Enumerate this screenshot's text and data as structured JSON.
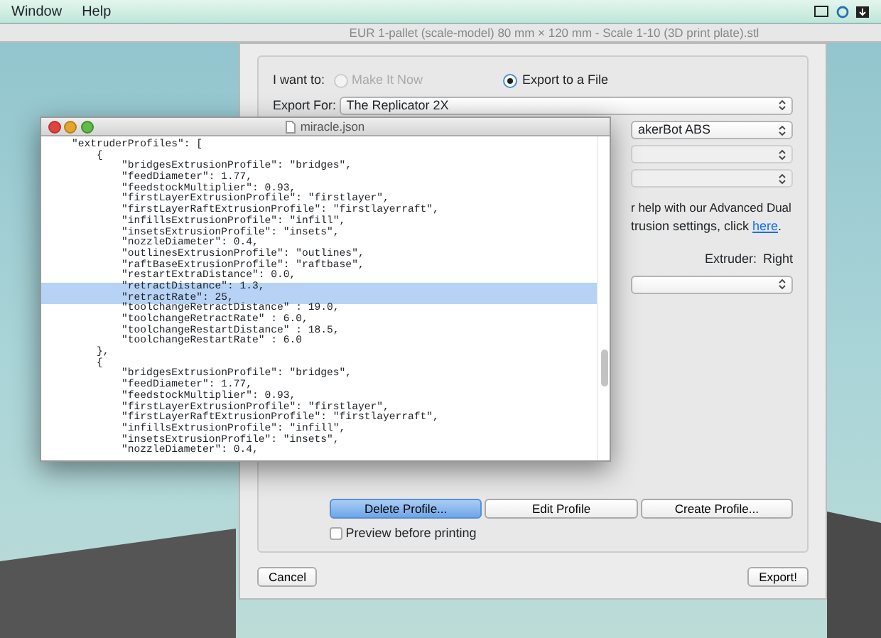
{
  "menu_bar": {
    "items": [
      "Window",
      "Help"
    ]
  },
  "window": {
    "title": "EUR 1-pallet (scale-model) 80 mm × 120 mm - Scale 1-10 (3D print plate).stl"
  },
  "export_dialog": {
    "intent_label": "I want to:",
    "intent_options": [
      {
        "label": "Make It Now",
        "selected": false,
        "disabled": true
      },
      {
        "label": "Export to a File",
        "selected": true,
        "disabled": false
      }
    ],
    "export_for": {
      "label": "Export For:",
      "value": "The Replicator 2X"
    },
    "dropdowns": [
      {
        "value": "akerBot ABS",
        "disabled": false
      },
      {
        "disabled": true
      },
      {
        "disabled": true
      }
    ],
    "help_text": {
      "line_1": "r help with our Advanced Dual",
      "line_2": "trusion settings, click ",
      "link": "here",
      "end": "."
    },
    "extruder": {
      "label": "Extruder:",
      "value": "Right"
    },
    "profile_dropdown": {
      "disabled": false
    },
    "profile_buttons": [
      {
        "label": "Delete Profile...",
        "selected": true
      },
      {
        "label": "Edit Profile",
        "selected": false
      },
      {
        "label": "Create Profile...",
        "selected": false
      }
    ],
    "preview_checkbox": {
      "label": "Preview before printing",
      "checked": false
    },
    "buttons": [
      "Cancel",
      "Export!"
    ]
  },
  "editor_window": {
    "title": "miracle.json",
    "lines": [
      {
        "text": "    \"extruderProfiles\": [",
        "selected": false
      },
      {
        "text": "        {",
        "selected": false
      },
      {
        "text": "            \"bridgesExtrusionProfile\": \"bridges\",",
        "selected": false
      },
      {
        "text": "            \"feedDiameter\": 1.77,",
        "selected": false
      },
      {
        "text": "            \"feedstockMultiplier\": 0.93,",
        "selected": false
      },
      {
        "text": "            \"firstLayerExtrusionProfile\": \"firstlayer\",",
        "selected": false
      },
      {
        "text": "            \"firstLayerRaftExtrusionProfile\": \"firstlayerraft\",",
        "selected": false
      },
      {
        "text": "            \"infillsExtrusionProfile\": \"infill\",",
        "selected": false
      },
      {
        "text": "            \"insetsExtrusionProfile\": \"insets\",",
        "selected": false
      },
      {
        "text": "            \"nozzleDiameter\": 0.4,",
        "selected": false
      },
      {
        "text": "            \"outlinesExtrusionProfile\": \"outlines\",",
        "selected": false
      },
      {
        "text": "            \"raftBaseExtrusionProfile\": \"raftbase\",",
        "selected": false
      },
      {
        "text": "            \"restartExtraDistance\": 0.0,",
        "selected": false
      },
      {
        "text": "            \"retractDistance\": 1.3,",
        "selected": true
      },
      {
        "text": "            \"retractRate\": 25,",
        "selected": true
      },
      {
        "text": "            \"toolchangeRetractDistance\" : 19.0,",
        "selected": false
      },
      {
        "text": "            \"toolchangeRetractRate\" : 6.0,",
        "selected": false
      },
      {
        "text": "            \"toolchangeRestartDistance\" : 18.5,",
        "selected": false
      },
      {
        "text": "            \"toolchangeRestartRate\" : 6.0",
        "selected": false
      },
      {
        "text": "        },",
        "selected": false
      },
      {
        "text": "        {",
        "selected": false
      },
      {
        "text": "            \"bridgesExtrusionProfile\": \"bridges\",",
        "selected": false
      },
      {
        "text": "            \"feedDiameter\": 1.77,",
        "selected": false
      },
      {
        "text": "            \"feedstockMultiplier\": 0.93,",
        "selected": false
      },
      {
        "text": "            \"firstLayerExtrusionProfile\": \"firstlayer\",",
        "selected": false
      },
      {
        "text": "            \"firstLayerRaftExtrusionProfile\": \"firstlayerraft\",",
        "selected": false
      },
      {
        "text": "            \"infillsExtrusionProfile\": \"infill\",",
        "selected": false
      },
      {
        "text": "            \"insetsExtrusionProfile\": \"insets\",",
        "selected": false
      },
      {
        "text": "            \"nozzleDiameter\": 0.4,",
        "selected": false
      }
    ]
  }
}
